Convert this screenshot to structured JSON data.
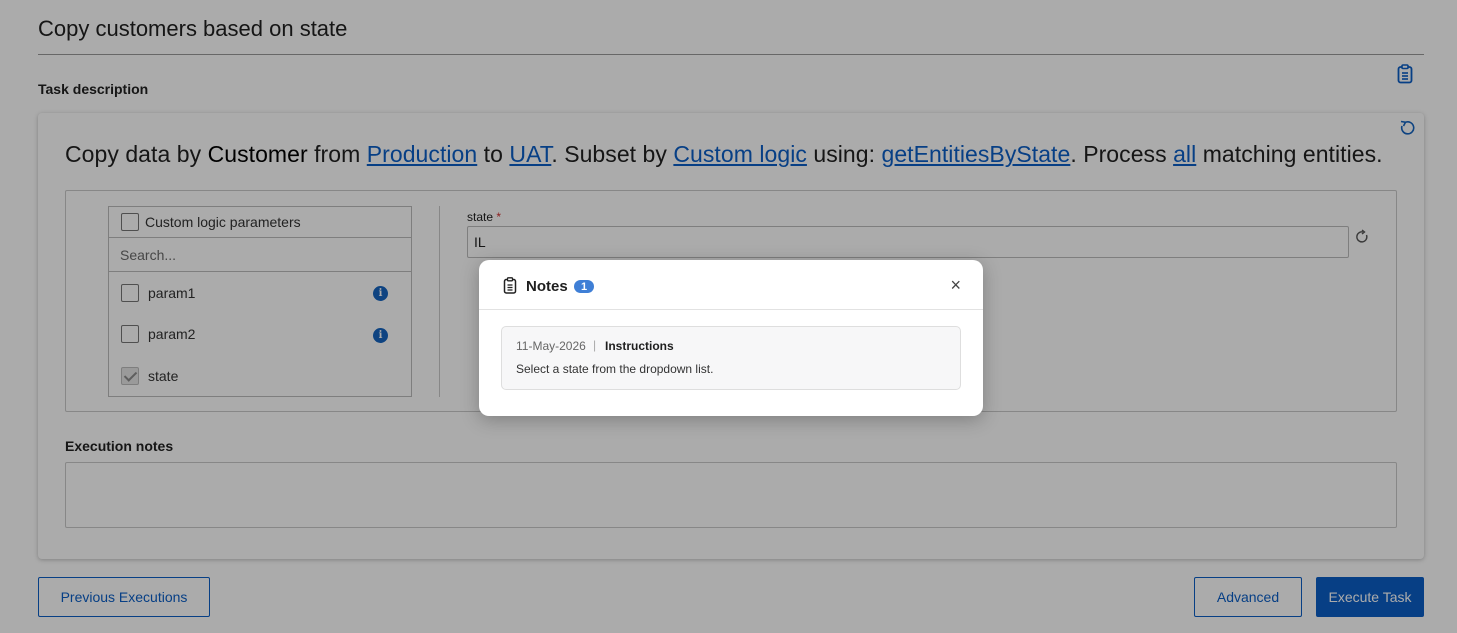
{
  "page": {
    "title": "Copy customers based on state",
    "task_description_label": "Task description"
  },
  "summary": {
    "p1": "Copy data by ",
    "entity": "Customer",
    "p2": " from ",
    "source": "Production",
    "p3": " to ",
    "target": "UAT",
    "p4": ". Subset by ",
    "subset": "Custom logic",
    "p5": " using: ",
    "function": "getEntitiesByState",
    "p6": ". Process ",
    "quantity": "all",
    "p7": " matching entities."
  },
  "params": {
    "header_label": "Custom logic parameters",
    "search_placeholder": "Search...",
    "items": [
      {
        "label": "param1",
        "checked": false
      },
      {
        "label": "param2",
        "checked": false
      },
      {
        "label": "state",
        "checked": true
      }
    ],
    "state_field": {
      "label": "state",
      "required_mark": "*",
      "value": "IL"
    }
  },
  "execution_notes": {
    "label": "Execution notes",
    "value": ""
  },
  "buttons": {
    "previous": "Previous Executions",
    "advanced": "Advanced",
    "execute": "Execute Task"
  },
  "notes_modal": {
    "title": "Notes",
    "count": "1",
    "close_glyph": "×",
    "notes": [
      {
        "date": "11-May-2026",
        "separator": "|",
        "title": "Instructions",
        "body": "Select a state from the dropdown list."
      }
    ]
  },
  "colors": {
    "accent": "#0b5fc7",
    "badge": "#3f7fd6",
    "required": "#d32f2f",
    "overlay": "rgba(0,0,0,0.33)"
  },
  "icons": [
    "clipboard-icon",
    "reset-icon",
    "info-icon",
    "checkbox-icon",
    "close-icon"
  ]
}
